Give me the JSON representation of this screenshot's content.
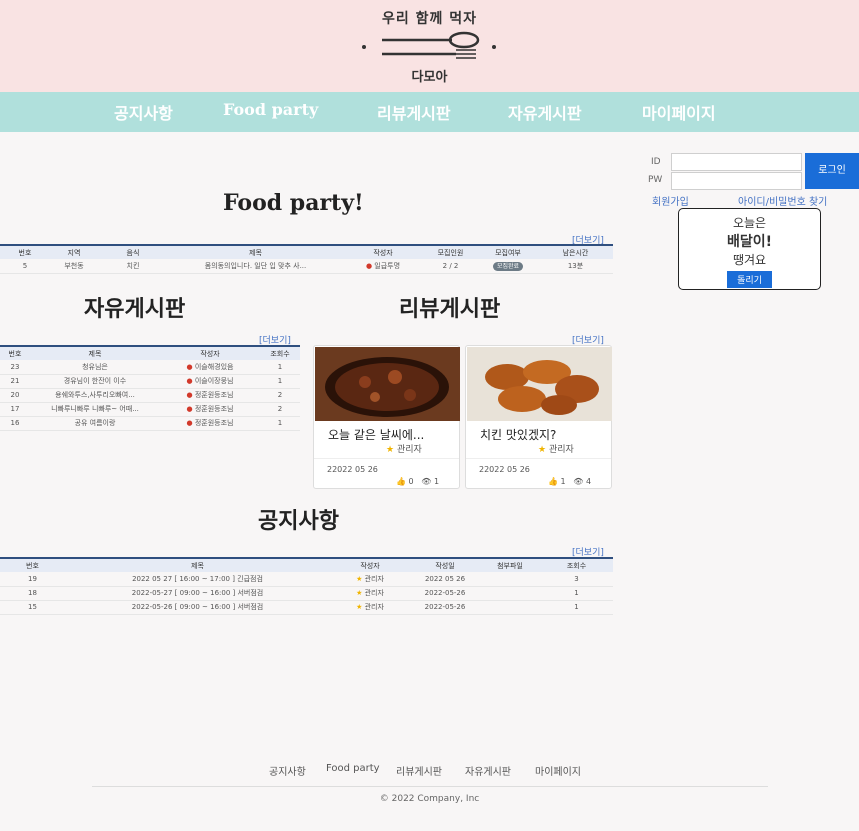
{
  "header": {
    "logo_top": "우리 함께 먹자",
    "logo_bottom": "다모아"
  },
  "nav": [
    "공지사항",
    "Food party",
    "리뷰게시판",
    "자유게시판",
    "마이페이지"
  ],
  "login": {
    "id_label": "ID",
    "pw_label": "PW",
    "button": "로그인",
    "signup": "회원가입",
    "find": "아이디/비밀번호 찾기"
  },
  "promo": {
    "line1": "오늘은",
    "line2": "배달이!",
    "line3": "땡겨요",
    "button": "돌리기"
  },
  "food_party": {
    "title": "Food party!",
    "more": "[더보기]",
    "headers": [
      "번호",
      "지역",
      "음식",
      "제목",
      "작성자",
      "모집인원",
      "모집여부",
      "남은시간"
    ],
    "rows": [
      [
        "5",
        "부천동",
        "치킨",
        "몸의동의입니다. 일단 입 맞추 사...",
        "일급투명",
        "2 / 2",
        "모집완료",
        "13분"
      ]
    ]
  },
  "free_board": {
    "title": "자유게시판",
    "more": "[더보기]",
    "headers": [
      "번호",
      "제목",
      "작성자",
      "조회수"
    ],
    "rows": [
      [
        "23",
        "청유님은",
        "이슬해경있음",
        "1"
      ],
      [
        "21",
        "경유님이 한잔이 이수",
        "이슬이장뭉님",
        "1"
      ],
      [
        "20",
        "용쉐와투스,사투리오빠여...",
        "정훈원등조님",
        "2"
      ],
      [
        "17",
        "니빠루니빠루 니빠루~ 어때...",
        "정훈원등조님",
        "2"
      ],
      [
        "16",
        "공유 여름이랑",
        "정훈원등조님",
        "1"
      ]
    ]
  },
  "review_board": {
    "title": "리뷰게시판",
    "more": "[더보기]",
    "cards": [
      {
        "title": "오늘 같은 날씨에...",
        "author": "관리자",
        "date": "22022 05 26",
        "likes": "0",
        "views": "1"
      },
      {
        "title": "치킨 맛있겠지?",
        "author": "관리자",
        "date": "22022 05 26",
        "likes": "1",
        "views": "4"
      }
    ]
  },
  "notice": {
    "title": "공지사항",
    "more": "[더보기]",
    "headers": [
      "번호",
      "제목",
      "작성자",
      "작성일",
      "첨부파일",
      "조회수"
    ],
    "rows": [
      [
        "19",
        "2022 05 27 [ 16:00 ~ 17:00 ] 긴급점검",
        "관리자",
        "2022 05 26",
        "",
        "3"
      ],
      [
        "18",
        "2022-05-27 [ 09:00 ~ 16:00 ] 서버점검",
        "관리자",
        "2022-05-26",
        "",
        "1"
      ],
      [
        "15",
        "2022-05-26 [ 09:00 ~ 16:00 ] 서버점검",
        "관리자",
        "2022-05-26",
        "",
        "1"
      ]
    ]
  },
  "footer": {
    "links": [
      "공지사항",
      "Food party",
      "리뷰게시판",
      "자유게시판",
      "마이페이지"
    ],
    "copyright": "© 2022 Company, Inc"
  }
}
